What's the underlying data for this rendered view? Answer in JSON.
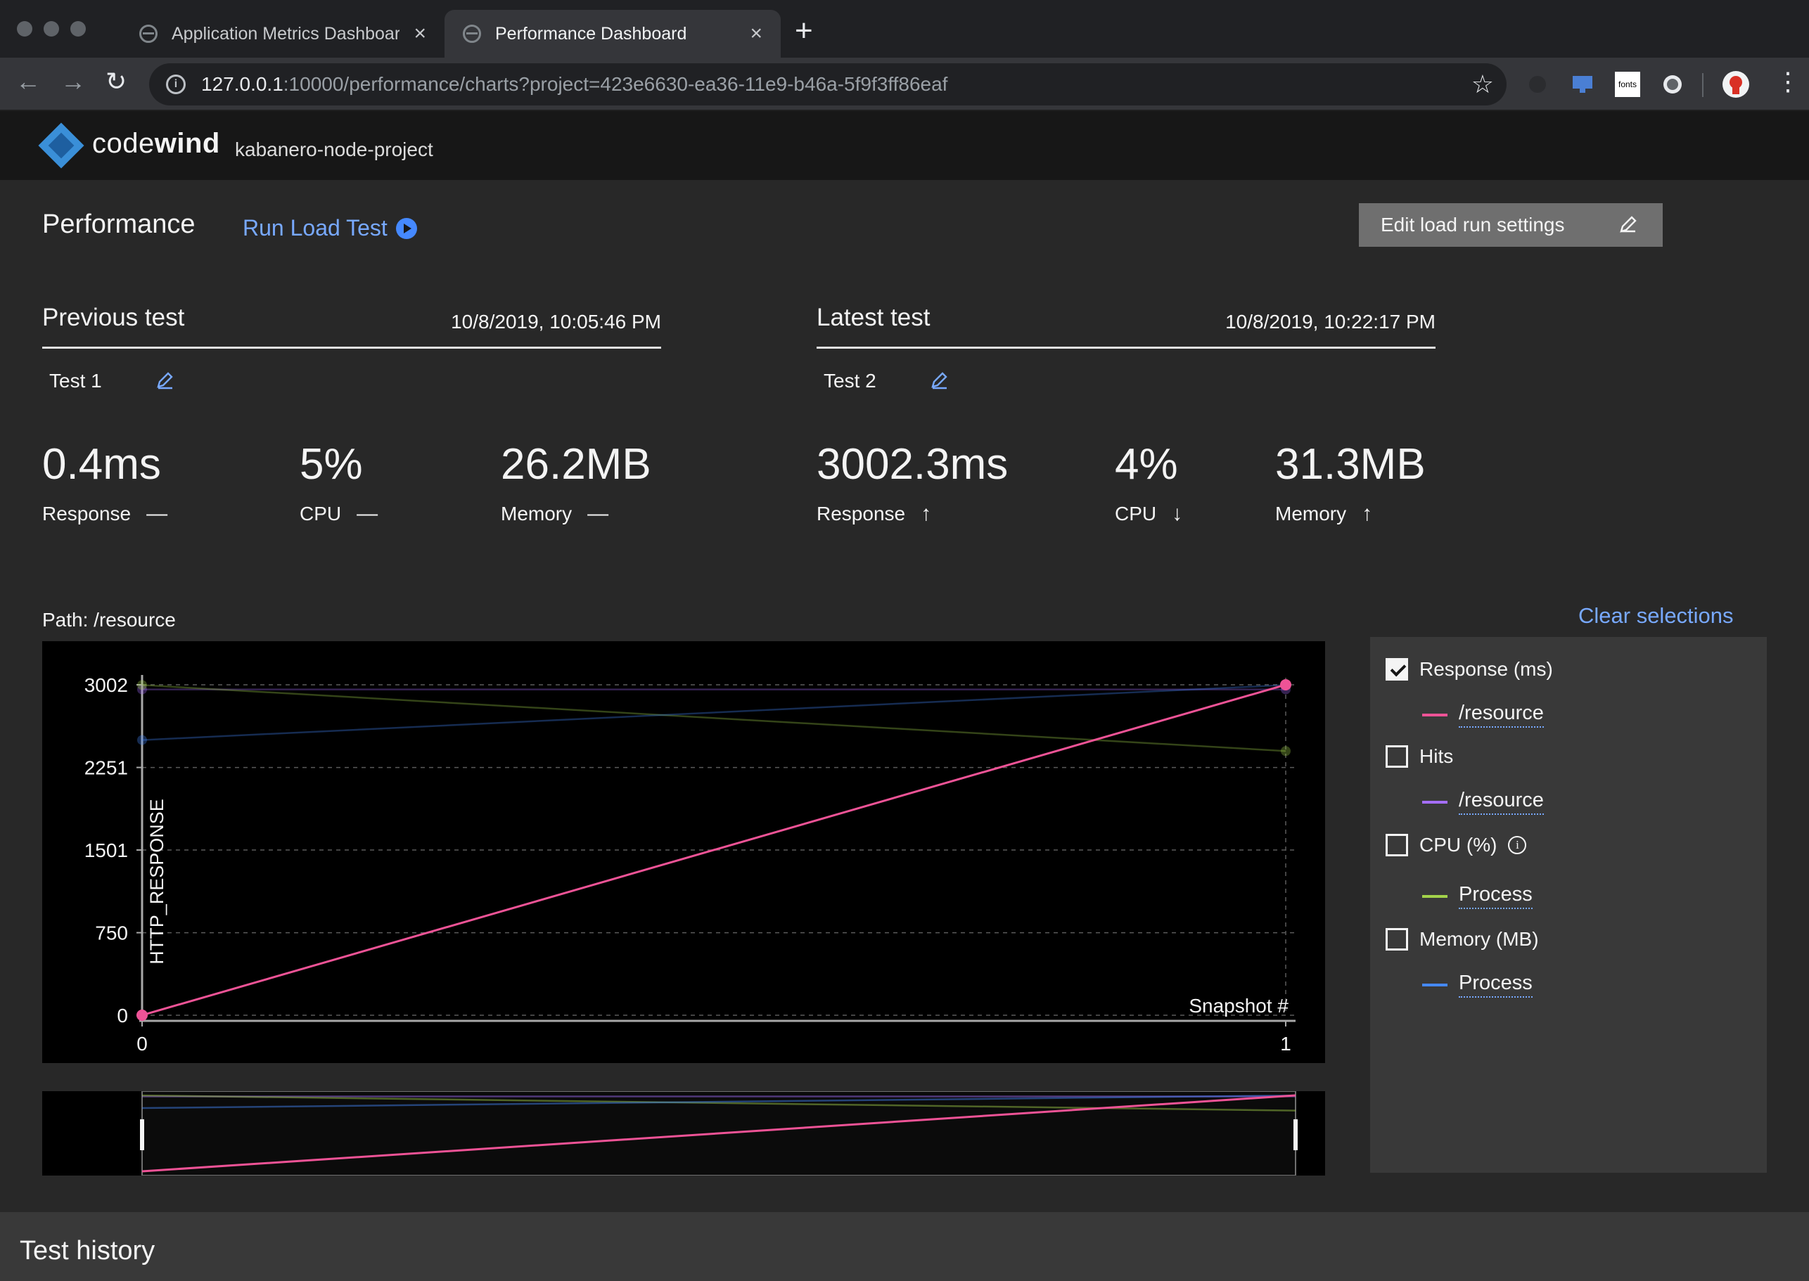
{
  "browser": {
    "tabs": [
      {
        "title": "Application Metrics Dashboard",
        "active": false
      },
      {
        "title": "Performance Dashboard",
        "active": true
      }
    ],
    "url_host": "127.0.0.1",
    "url_rest": ":10000/performance/charts?project=423e6630-ea36-11e9-b46a-5f9f3ff86eaf",
    "ext_fonts_label": "fonts"
  },
  "app": {
    "brand_light": "code",
    "brand_bold": "wind",
    "project": "kabanero-node-project"
  },
  "header": {
    "title": "Performance",
    "run_load_test": "Run Load Test",
    "edit_settings": "Edit load run settings"
  },
  "previous": {
    "label": "Previous test",
    "date": "10/8/2019, 10:05:46 PM",
    "name": "Test 1",
    "response": "0.4ms",
    "response_label": "Response",
    "response_trend": "—",
    "cpu": "5%",
    "cpu_label": "CPU",
    "cpu_trend": "—",
    "memory": "26.2MB",
    "memory_label": "Memory",
    "memory_trend": "—"
  },
  "latest": {
    "label": "Latest test",
    "date": "10/8/2019, 10:22:17 PM",
    "name": "Test 2",
    "response": "3002.3ms",
    "response_label": "Response",
    "response_trend": "↑",
    "cpu": "4%",
    "cpu_label": "CPU",
    "cpu_trend": "↓",
    "memory": "31.3MB",
    "memory_label": "Memory",
    "memory_trend": "↑"
  },
  "chart_section": {
    "path_label": "Path: /resource",
    "clear_selections": "Clear selections"
  },
  "legend": {
    "groups": [
      {
        "label": "Response (ms)",
        "checked": true,
        "sub": "/resource",
        "color": "#ee5396",
        "info": false
      },
      {
        "label": "Hits",
        "checked": false,
        "sub": "/resource",
        "color": "#a56eff",
        "info": false
      },
      {
        "label": "CPU (%)",
        "checked": false,
        "sub": "Process",
        "color": "#a3d24a",
        "info": true
      },
      {
        "label": "Memory (MB)",
        "checked": false,
        "sub": "Process",
        "color": "#4589ff",
        "info": false
      }
    ]
  },
  "chart_data": {
    "type": "line",
    "ylabel": "HTTP_RESPONSE",
    "xlabel": "Snapshot #",
    "x": [
      0,
      1
    ],
    "xticks": [
      "0",
      "1"
    ],
    "yticks": [
      "0",
      "750",
      "1501",
      "2251",
      "3002"
    ],
    "ylim": [
      0,
      3002
    ],
    "grid": true,
    "series": [
      {
        "name": "/resource",
        "color": "#ee5396",
        "values": [
          0.4,
          3002.3
        ],
        "selected": true
      },
      {
        "name": "/resource",
        "color": "#a56eff",
        "values": [
          2960,
          2960
        ],
        "selected": false
      },
      {
        "name": "Process",
        "color": "#a3d24a",
        "values": [
          3000,
          2400
        ],
        "selected": false
      },
      {
        "name": "Process",
        "color": "#4589ff",
        "values": [
          2500,
          3000
        ],
        "selected": false
      }
    ]
  },
  "history": {
    "title": "Test history"
  }
}
